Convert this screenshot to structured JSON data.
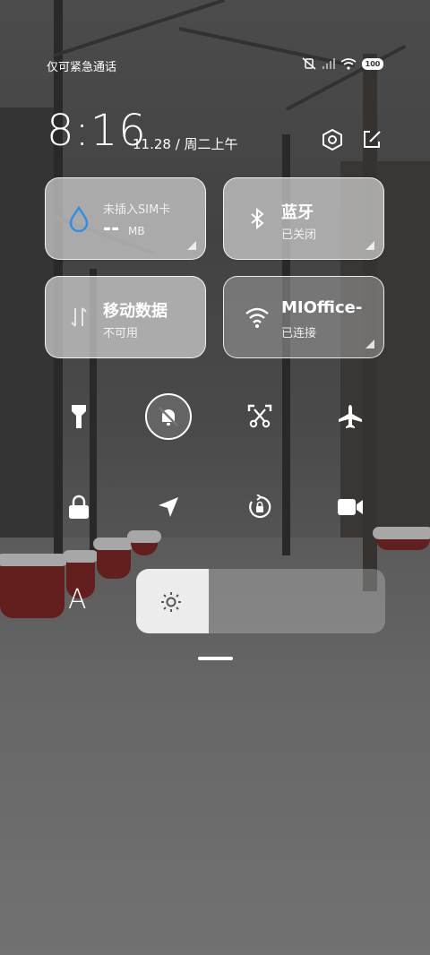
{
  "status_bar": {
    "carrier": "仅可紧急通话",
    "battery": "100"
  },
  "header": {
    "time": "8:16",
    "date": "11.28 / 周二上午"
  },
  "tiles": {
    "data_usage": {
      "title": "--",
      "unit": "MB",
      "subtitle": "未插入SIM卡"
    },
    "bluetooth": {
      "title": "蓝牙",
      "subtitle": "已关闭"
    },
    "mobile_data": {
      "title": "移动数据",
      "subtitle": "不可用"
    },
    "wifi": {
      "title": "MIOffice-",
      "subtitle": "已连接"
    }
  },
  "quick_icons": [
    {
      "name": "flashlight-icon"
    },
    {
      "name": "mute-bell-icon",
      "active": true
    },
    {
      "name": "screenshot-icon"
    },
    {
      "name": "airplane-icon"
    },
    {
      "name": "lock-icon"
    },
    {
      "name": "location-icon"
    },
    {
      "name": "rotation-lock-icon"
    },
    {
      "name": "video-camera-icon"
    }
  ],
  "brightness": {
    "level": 0.29,
    "label": "A"
  },
  "colors": {
    "accent_blue": "#2f8fe6",
    "tile_border": "#ffffff"
  }
}
